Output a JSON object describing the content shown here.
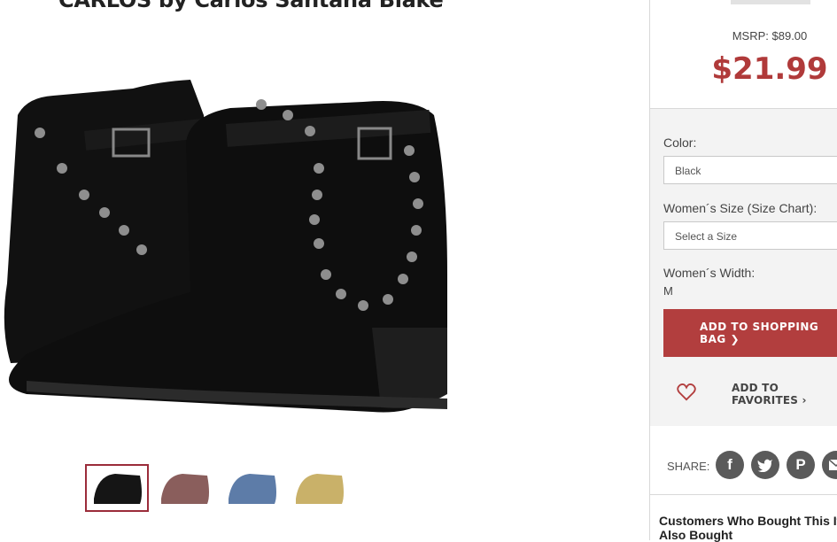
{
  "product": {
    "title": "CARLOS by Carlos Santana Blake",
    "msrp": "MSRP: $89.00",
    "price": "$21.99"
  },
  "thumbnails": [
    {
      "name": "black",
      "color": "#151515"
    },
    {
      "name": "mauve",
      "color": "#8a5e5c"
    },
    {
      "name": "blue",
      "color": "#5d7ca8"
    },
    {
      "name": "tan",
      "color": "#c9b169"
    }
  ],
  "options": {
    "color_label": "Color:",
    "color_value": "Black",
    "size_label": "Women´s Size (Size Chart):",
    "size_placeholder": "Select a Size",
    "width_label": "Women´s Width:",
    "width_value": "M"
  },
  "actions": {
    "add_to_bag": "ADD TO SHOPPING BAG ❯",
    "add_to_favorites": "ADD TO FAVORITES ›"
  },
  "share": {
    "label": "SHARE:",
    "icons": [
      "facebook-icon",
      "twitter-icon",
      "pinterest-icon",
      "email-icon"
    ]
  },
  "recommendations": {
    "heading": "Customers Who Bought This Item Also Bought"
  },
  "colors": {
    "accent": "#b23e3e",
    "selected_border": "#9b2c3a"
  }
}
